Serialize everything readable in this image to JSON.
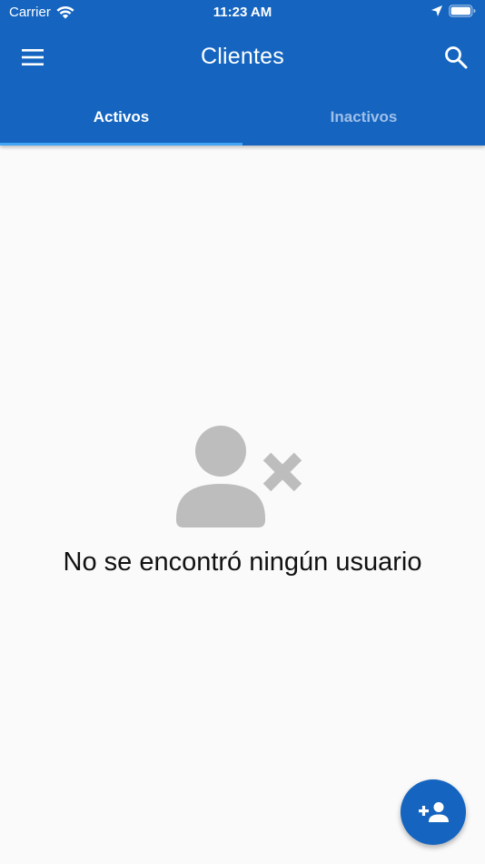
{
  "status_bar": {
    "carrier": "Carrier",
    "time": "11:23 AM"
  },
  "app_bar": {
    "title": "Clientes",
    "menu_icon": "menu-icon",
    "search_icon": "search-icon",
    "background_color": "#1565c0"
  },
  "tabs": [
    {
      "label": "Activos",
      "selected": true
    },
    {
      "label": "Inactivos",
      "selected": false
    }
  ],
  "empty_state": {
    "icon": "person-remove-icon",
    "message": "No se encontró ningún usuario"
  },
  "fab": {
    "icon": "person-add-icon",
    "color": "#1565c0"
  },
  "colors": {
    "accent": "#42a5f5",
    "background": "#fafafa",
    "icon_gray": "#bdbdbd"
  }
}
